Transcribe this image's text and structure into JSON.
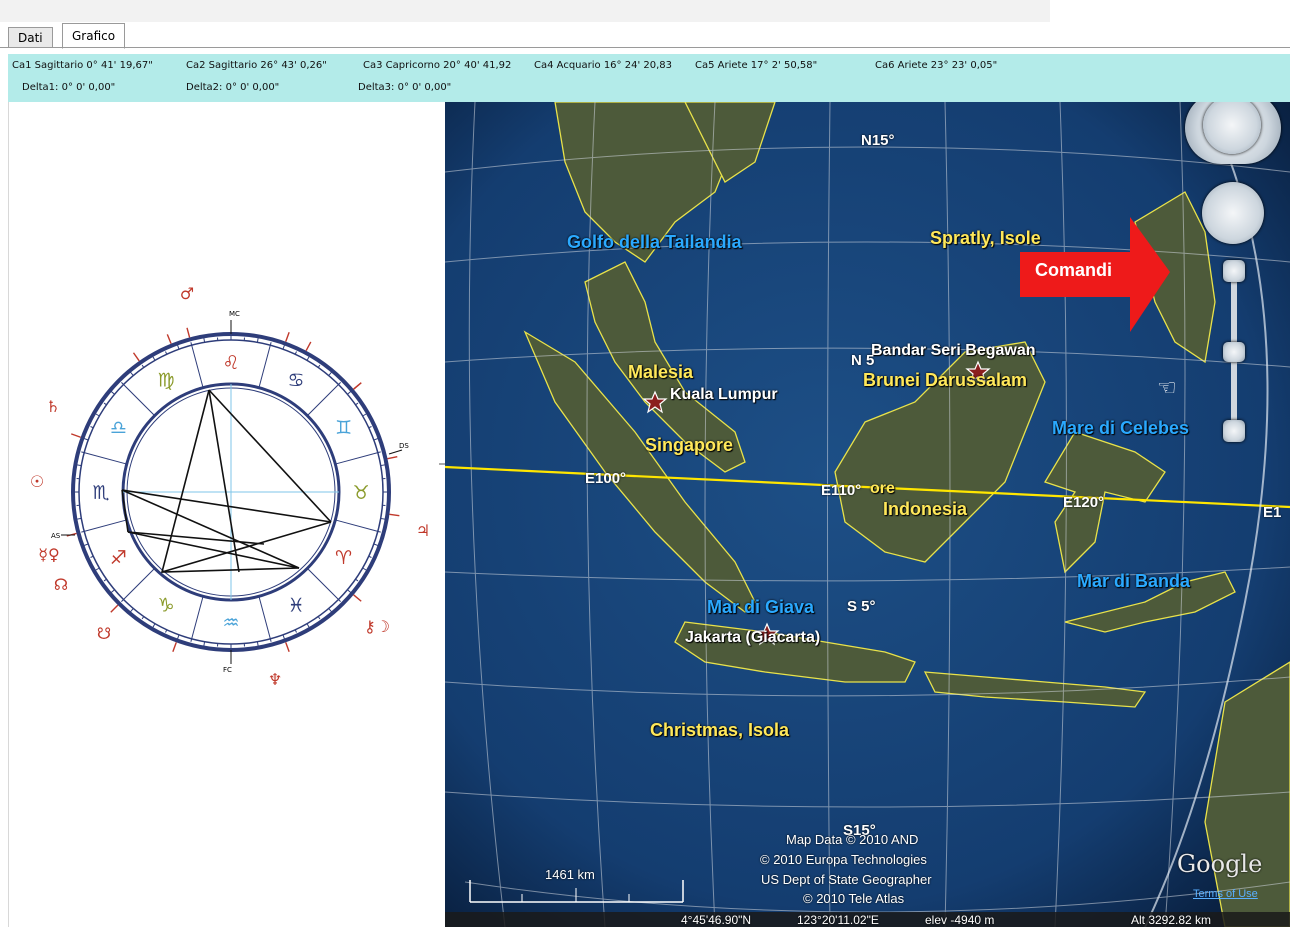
{
  "tabs": [
    {
      "label": "Dati"
    },
    {
      "label": "Grafico"
    }
  ],
  "cusps_row1": [
    "Ca1 Sagittario 0° 41' 19,67\"",
    "Ca2 Sagittario 26° 43' 0,26\"",
    "Ca3 Capricorno 20° 40' 41,92",
    "Ca4 Acquario 16° 24' 20,83",
    "Ca5 Ariete 17° 2' 50,58\"",
    "Ca6 Ariete 23° 23' 0,05\""
  ],
  "deltas": [
    "Delta1: 0° 0' 0,00\"",
    "Delta2: 0° 0' 0,00\"",
    "Delta3: 0° 0' 0,00\""
  ],
  "chart": {
    "angles": {
      "mc": "MC",
      "ds": "DS",
      "as": "AS",
      "fc": "FC"
    },
    "signs": [
      {
        "glyph": "♌"
      },
      {
        "glyph": "♋"
      },
      {
        "glyph": "♊"
      },
      {
        "glyph": "♉"
      },
      {
        "glyph": "♈"
      },
      {
        "glyph": "♓"
      },
      {
        "glyph": "♒"
      },
      {
        "glyph": "♑"
      },
      {
        "glyph": "♐"
      },
      {
        "glyph": "♏"
      },
      {
        "glyph": "♎"
      },
      {
        "glyph": "♍"
      }
    ],
    "planets": [
      {
        "glyph": "♂"
      },
      {
        "glyph": "♄"
      },
      {
        "glyph": "☉"
      },
      {
        "glyph": "☿♀"
      },
      {
        "glyph": "☊"
      },
      {
        "glyph": "☋"
      },
      {
        "glyph": "♃"
      },
      {
        "glyph": "⚷☽"
      },
      {
        "glyph": "♆"
      }
    ]
  },
  "map": {
    "labels": {
      "golfo": "Golfo della Tailandia",
      "spratly": "Spratly, Isole",
      "malesia": "Malesia",
      "kuala": "Kuala Lumpur",
      "singapore": "Singapore",
      "bandar": "Bandar Seri Begawan",
      "brunei": "Brunei Darussalam",
      "celebes": "Mare di Celebes",
      "indonesia": "Indonesia",
      "banda": "Mar di Banda",
      "giava": "Mar di Giava",
      "jakarta": "Jakarta (Giacarta)",
      "christmas": "Christmas, Isola",
      "n15": "N15°",
      "n5": "N 5",
      "e100": "E100°",
      "e110": "E110°",
      "e120": "E120°",
      "e1": "E1",
      "s5": "S 5°",
      "s15": "S15°",
      "ore": "ore"
    },
    "callout": "Comandi",
    "scale": "1461 km",
    "credits": [
      "Map Data © 2010 AND",
      "© 2010 Europa Technologies",
      "US Dept of State Geographer",
      "© 2010 Tele Atlas"
    ],
    "status": {
      "lat": "4°45'46.90\"N",
      "lon": "123°20'11.02\"E",
      "elev": "elev -4940 m",
      "alt": "Alt  3292.82 km"
    },
    "brand": "Google",
    "terms": "Terms of Use"
  }
}
